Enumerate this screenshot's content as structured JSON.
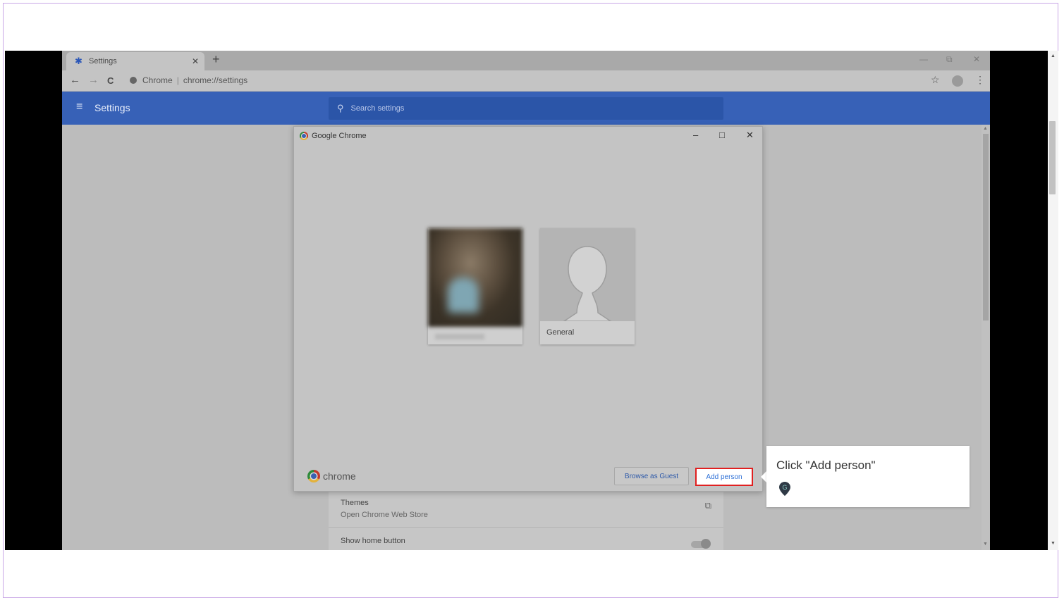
{
  "browser": {
    "tab": {
      "title": "Settings",
      "icon": "gear-icon",
      "close_label": "✕"
    },
    "new_tab_label": "+",
    "window_controls": {
      "minimize": "—",
      "restore": "⧉",
      "close": "✕"
    },
    "toolbar": {
      "back": "←",
      "forward": "→",
      "reload": "C",
      "origin": "Chrome",
      "separator": "|",
      "url": "chrome://settings",
      "bookmark": "☆",
      "menu": "⋮"
    }
  },
  "settings_header": {
    "menu_icon": "≡",
    "title": "Settings",
    "search_placeholder": "Search settings"
  },
  "settings_rows": [
    {
      "title": "Themes",
      "subtitle": "Open Chrome Web Store"
    },
    {
      "title": "Show home button"
    }
  ],
  "dialog": {
    "title": "Google Chrome",
    "controls": {
      "minimize": "–",
      "maximize": "□",
      "close": "✕"
    },
    "profiles": [
      {
        "name": "",
        "type": "photo"
      },
      {
        "name": "General",
        "type": "generic"
      }
    ],
    "brand_word": "chrome",
    "browse_as_guest": "Browse as Guest",
    "add_person": "Add person"
  },
  "callout": {
    "text": "Click \"Add person\"",
    "pin_letter": "G"
  },
  "colors": {
    "settings_blue": "#3761b7",
    "highlight_red": "#e02020",
    "button_text_blue": "#2c6fd6",
    "frame_border": "#c9a7e6"
  }
}
